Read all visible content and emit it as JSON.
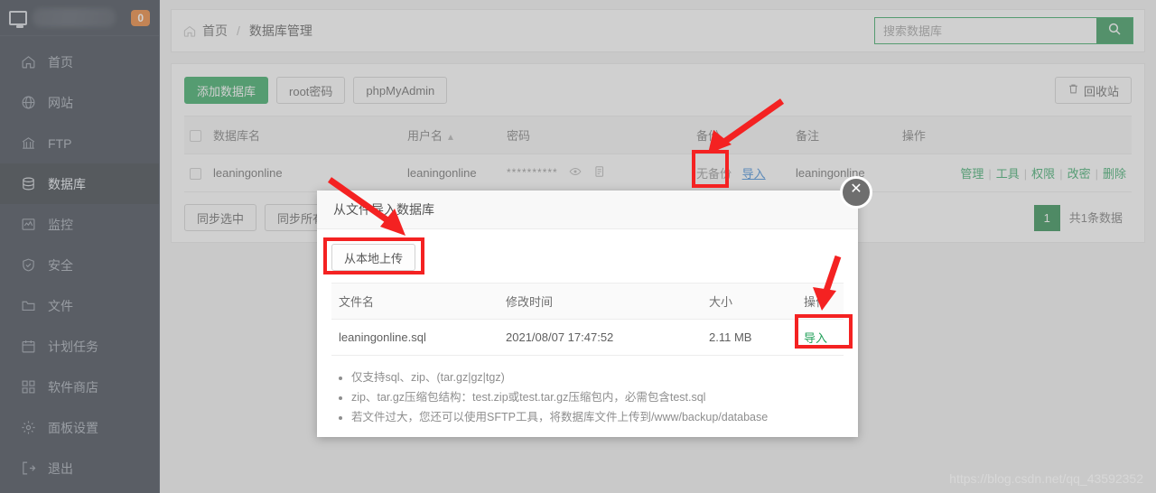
{
  "sidebar": {
    "brand": {
      "icon": "monitor-icon",
      "name_redacted": true,
      "badge": "0"
    },
    "items": [
      {
        "label": "首页",
        "icon": "home-icon",
        "active": false
      },
      {
        "label": "网站",
        "icon": "globe-icon",
        "active": false
      },
      {
        "label": "FTP",
        "icon": "ftp-icon",
        "active": false
      },
      {
        "label": "数据库",
        "icon": "database-icon",
        "active": true
      },
      {
        "label": "监控",
        "icon": "monitor-chart-icon",
        "active": false
      },
      {
        "label": "安全",
        "icon": "shield-icon",
        "active": false
      },
      {
        "label": "文件",
        "icon": "folder-icon",
        "active": false
      },
      {
        "label": "计划任务",
        "icon": "calendar-icon",
        "active": false
      },
      {
        "label": "软件商店",
        "icon": "grid-icon",
        "active": false
      },
      {
        "label": "面板设置",
        "icon": "gear-icon",
        "active": false
      },
      {
        "label": "退出",
        "icon": "logout-icon",
        "active": false
      }
    ]
  },
  "header": {
    "breadcrumb_home": "首页",
    "breadcrumb_sep": "/",
    "breadcrumb_current": "数据库管理",
    "search_placeholder": "搜索数据库",
    "search_value": ""
  },
  "toolbar": {
    "add_db": "添加数据库",
    "root_password": "root密码",
    "phpmyadmin": "phpMyAdmin",
    "recycle_bin": "回收站"
  },
  "table": {
    "headers": [
      "数据库名",
      "用户名",
      "密码",
      "备份",
      "备注",
      "操作"
    ],
    "sort_column": "用户名",
    "sort_dir": "▲",
    "rows": [
      {
        "db_name": "leaningonline",
        "user_name": "leaningonline",
        "password_mask": "**********",
        "backup": "无备份",
        "import_link": "导入",
        "remark": "leaningonline",
        "ops": [
          "管理",
          "工具",
          "权限",
          "改密",
          "删除"
        ]
      }
    ]
  },
  "footer": {
    "sync_selected": "同步选中",
    "sync_all": "同步所有",
    "page_number": "1",
    "total_text": "共1条数据"
  },
  "modal": {
    "title": "从文件导入数据库",
    "upload_button": "从本地上传",
    "close_icon": "close-icon",
    "file_table": {
      "headers": [
        "文件名",
        "修改时间",
        "大小",
        "操作"
      ],
      "rows": [
        {
          "file_name": "leaningonline.sql",
          "modified": "2021/08/07 17:47:52",
          "size": "2.11 MB",
          "action": "导入"
        }
      ]
    },
    "tips": [
      "仅支持sql、zip、(tar.gz|gz|tgz)",
      "zip、tar.gz压缩包结构：test.zip或test.tar.gz压缩包内，必需包含test.sql",
      "若文件过大，您还可以使用SFTP工具，将数据库文件上传到/www/backup/database"
    ]
  },
  "annotations": {
    "color": "#f42222",
    "highlight_count": 3
  },
  "watermark": "https://blog.csdn.net/qq_43592352"
}
